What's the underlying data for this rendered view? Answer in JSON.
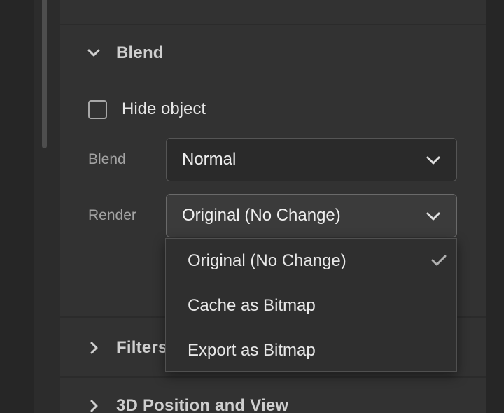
{
  "blend_section": {
    "title": "Blend",
    "hide_object": {
      "label": "Hide object",
      "checked": false
    },
    "blend": {
      "label": "Blend",
      "value": "Normal"
    },
    "render": {
      "label": "Render",
      "value": "Original (No Change)",
      "options": [
        {
          "label": "Original (No Change)",
          "selected": true
        },
        {
          "label": "Cache as Bitmap",
          "selected": false
        },
        {
          "label": "Export as Bitmap",
          "selected": false
        }
      ]
    }
  },
  "filters_section": {
    "title": "Filters"
  },
  "position_section": {
    "title": "3D Position and View"
  }
}
